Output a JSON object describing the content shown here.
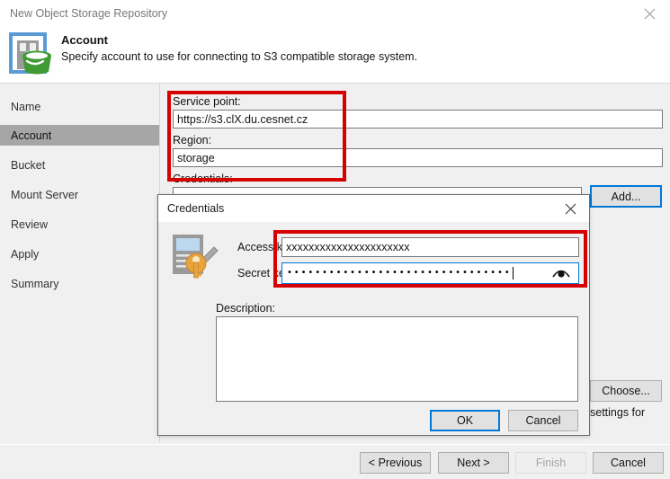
{
  "window": {
    "title": "New Object Storage Repository",
    "close_icon": "close-icon"
  },
  "header": {
    "title": "Account",
    "subtitle": "Specify account to use for connecting to S3 compatible storage system.",
    "icon": "object-storage-bucket-icon"
  },
  "sidebar": {
    "items": [
      {
        "label": "Name",
        "selected": false
      },
      {
        "label": "Account",
        "selected": true
      },
      {
        "label": "Bucket",
        "selected": false
      },
      {
        "label": "Mount Server",
        "selected": false
      },
      {
        "label": "Review",
        "selected": false
      },
      {
        "label": "Apply",
        "selected": false
      },
      {
        "label": "Summary",
        "selected": false
      }
    ]
  },
  "main": {
    "service_point_label": "Service point:",
    "service_point_value": "https://s3.clX.du.cesnet.cz",
    "region_label": "Region:",
    "region_value": "storage",
    "credentials_label": "Credentials:",
    "add_button": "Add...",
    "choose_button": "Choose...",
    "background_text": "settings for"
  },
  "dialog": {
    "title": "Credentials",
    "close_icon": "close-icon",
    "icon": "credentials-key-icon",
    "access_key_label": "Access key:",
    "access_key_value": "xxxxxxxxxxxxxxxxxxxxxx",
    "secret_key_label": "Secret key:",
    "secret_key_value": "••••••••••••••••••••••••••••••••",
    "reveal_icon": "eye-icon",
    "description_label": "Description:",
    "description_value": "",
    "ok_button": "OK",
    "cancel_button": "Cancel"
  },
  "footer": {
    "previous_button": "< Previous",
    "next_button": "Next >",
    "finish_button": "Finish",
    "cancel_button": "Cancel"
  },
  "colors": {
    "accent": "#0078d7",
    "annotation": "#d60000",
    "window_bg": "#f0f0f0",
    "selected_item": "#a6a6a6",
    "bucket_green": "#3f9c35",
    "bucket_blue": "#5b9bd5"
  }
}
